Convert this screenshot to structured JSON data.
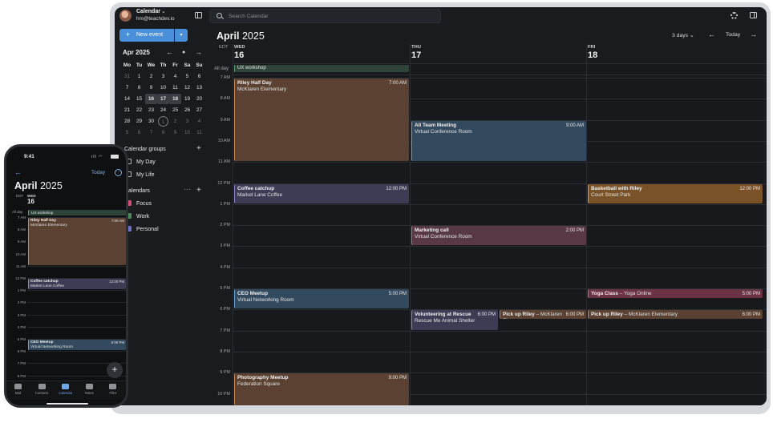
{
  "app": {
    "account_name": "Calendar",
    "account_email": "hm@teachdev.io",
    "search_placeholder": "Search Calendar",
    "new_event_label": "New event"
  },
  "mini_month": {
    "title": "Apr 2025",
    "weekday_headers": [
      "Mo",
      "Tu",
      "We",
      "Th",
      "Fr",
      "Sa",
      "Su"
    ],
    "weeks": [
      [
        "31",
        "1",
        "2",
        "3",
        "4",
        "5",
        "6"
      ],
      [
        "7",
        "8",
        "9",
        "10",
        "11",
        "12",
        "13"
      ],
      [
        "14",
        "15",
        "16",
        "17",
        "18",
        "19",
        "20"
      ],
      [
        "21",
        "22",
        "23",
        "24",
        "25",
        "26",
        "27"
      ],
      [
        "28",
        "29",
        "30",
        "1",
        "2",
        "3",
        "4"
      ],
      [
        "5",
        "6",
        "7",
        "8",
        "9",
        "10",
        "11"
      ]
    ]
  },
  "sidebar": {
    "groups_title": "Calendar groups",
    "groups": [
      "My Day",
      "My Life"
    ],
    "calendars_title": "Calendars",
    "calendars": [
      {
        "name": "Focus",
        "color": "#d24c7a"
      },
      {
        "name": "Work",
        "color": "#4e8a5e"
      },
      {
        "name": "Personal",
        "color": "#6f6fc8"
      }
    ]
  },
  "main": {
    "month": "April",
    "year": "2025",
    "view_label": "3 days",
    "today_label": "Today",
    "tz_label": "EDT",
    "allday_label": "All day",
    "days": [
      {
        "name": "WED",
        "date": "16"
      },
      {
        "name": "THU",
        "date": "17"
      },
      {
        "name": "FRI",
        "date": "18"
      }
    ],
    "hours": [
      "7 AM",
      "8 AM",
      "9 AM",
      "10 AM",
      "11 AM",
      "12 PM",
      "1 PM",
      "2 PM",
      "3 PM",
      "4 PM",
      "5 PM",
      "6 PM",
      "7 PM",
      "8 PM",
      "9 PM",
      "10 PM"
    ],
    "allday_events": [
      {
        "title": "UX workshop",
        "day": 0
      }
    ],
    "events": [
      {
        "title": "Riley Half Day",
        "location": "McKlaren Elementary",
        "time": "7:00 AM",
        "day": 0,
        "start": 7,
        "end": 11,
        "color": "#5a4131",
        "border": "#c98a58"
      },
      {
        "title": "All Team Meeting",
        "location": "Virtual Conference Room",
        "time": "9:00 AM",
        "day": 1,
        "start": 9,
        "end": 11,
        "color": "#33495e",
        "border": "#6aa2d6"
      },
      {
        "title": "Coffee catchup",
        "location": "Market Lane Coffee",
        "time": "12:00 PM",
        "day": 0,
        "start": 12,
        "end": 13,
        "color": "#3e3c54",
        "border": "#8a86c8"
      },
      {
        "title": "Basketball with Riley",
        "location": "Court Street Park",
        "time": "12:00 PM",
        "day": 2,
        "start": 12,
        "end": 13,
        "color": "#7a5228",
        "border": "#e0954a"
      },
      {
        "title": "Marketing call",
        "location": "Virtual Conference Room",
        "time": "2:00 PM",
        "day": 1,
        "start": 14,
        "end": 15,
        "color": "#583845",
        "border": "#c07088"
      },
      {
        "title": "CEO Meetup",
        "location": "Virtual Networking Room",
        "time": "5:00 PM",
        "day": 0,
        "start": 17,
        "end": 18,
        "color": "#33495e",
        "border": "#6aa2d6"
      },
      {
        "title": "Yoga Class",
        "sub": "– Yoga Online",
        "time": "5:00 PM",
        "day": 2,
        "start": 17,
        "end": 17.5,
        "color": "#6b3244",
        "border": "#d8607c"
      },
      {
        "title": "Volunteering at Rescue",
        "location": "Rescue Me Animal Shelter",
        "time": "6:00 PM",
        "day": 1,
        "start": 18,
        "end": 19,
        "half": "left",
        "color": "#3e3c54",
        "border": "#8a86c8"
      },
      {
        "title": "Pick up Riley",
        "sub": "– McKlaren Elementary",
        "time": "6:00 PM",
        "day": 1,
        "start": 18,
        "end": 18.5,
        "half": "right",
        "color": "#5a4131",
        "border": "#c98a58"
      },
      {
        "title": "Pick up Riley",
        "sub": "– McKlaren Elementary",
        "time": "6:00 PM",
        "day": 2,
        "start": 18,
        "end": 18.5,
        "color": "#5a4131",
        "border": "#c98a58"
      },
      {
        "title": "Photography Meetup",
        "location": "Federation Square",
        "time": "9:00 PM",
        "day": 0,
        "start": 21,
        "end": 22.6,
        "color": "#5a4131",
        "border": "#c98a58"
      }
    ]
  },
  "phone": {
    "status_time": "9:41",
    "today_label": "Today",
    "month": "April",
    "year": "2025",
    "tz_label": "EDT",
    "day_name": "WED",
    "day_date": "16",
    "allday_label": "All day",
    "allday_event": "UX workshop",
    "hours": [
      "7 AM",
      "8 AM",
      "9 AM",
      "10 AM",
      "11 AM",
      "12 PM",
      "1 PM",
      "2 PM",
      "3 PM",
      "4 PM",
      "5 PM",
      "6 PM",
      "7 PM",
      "8 PM"
    ],
    "events": [
      {
        "title": "Riley Half Day",
        "location": "McKlaren Elementary",
        "time": "7:00 AM",
        "start": 7,
        "end": 11,
        "color": "#5a4131",
        "border": "#c98a58"
      },
      {
        "title": "Coffee catchup",
        "location": "Market Lane Coffee",
        "time": "12:00 PM",
        "start": 12,
        "end": 13,
        "color": "#3e3c54",
        "border": "#8a86c8"
      },
      {
        "title": "CEO Meetup",
        "location": "Virtual Networking Room",
        "time": "5:00 PM",
        "start": 17,
        "end": 18,
        "color": "#33495e",
        "border": "#6aa2d6"
      }
    ],
    "tabs": [
      "Mail",
      "Contacts",
      "Calendar",
      "Notes",
      "Files"
    ],
    "active_tab": "Calendar"
  }
}
